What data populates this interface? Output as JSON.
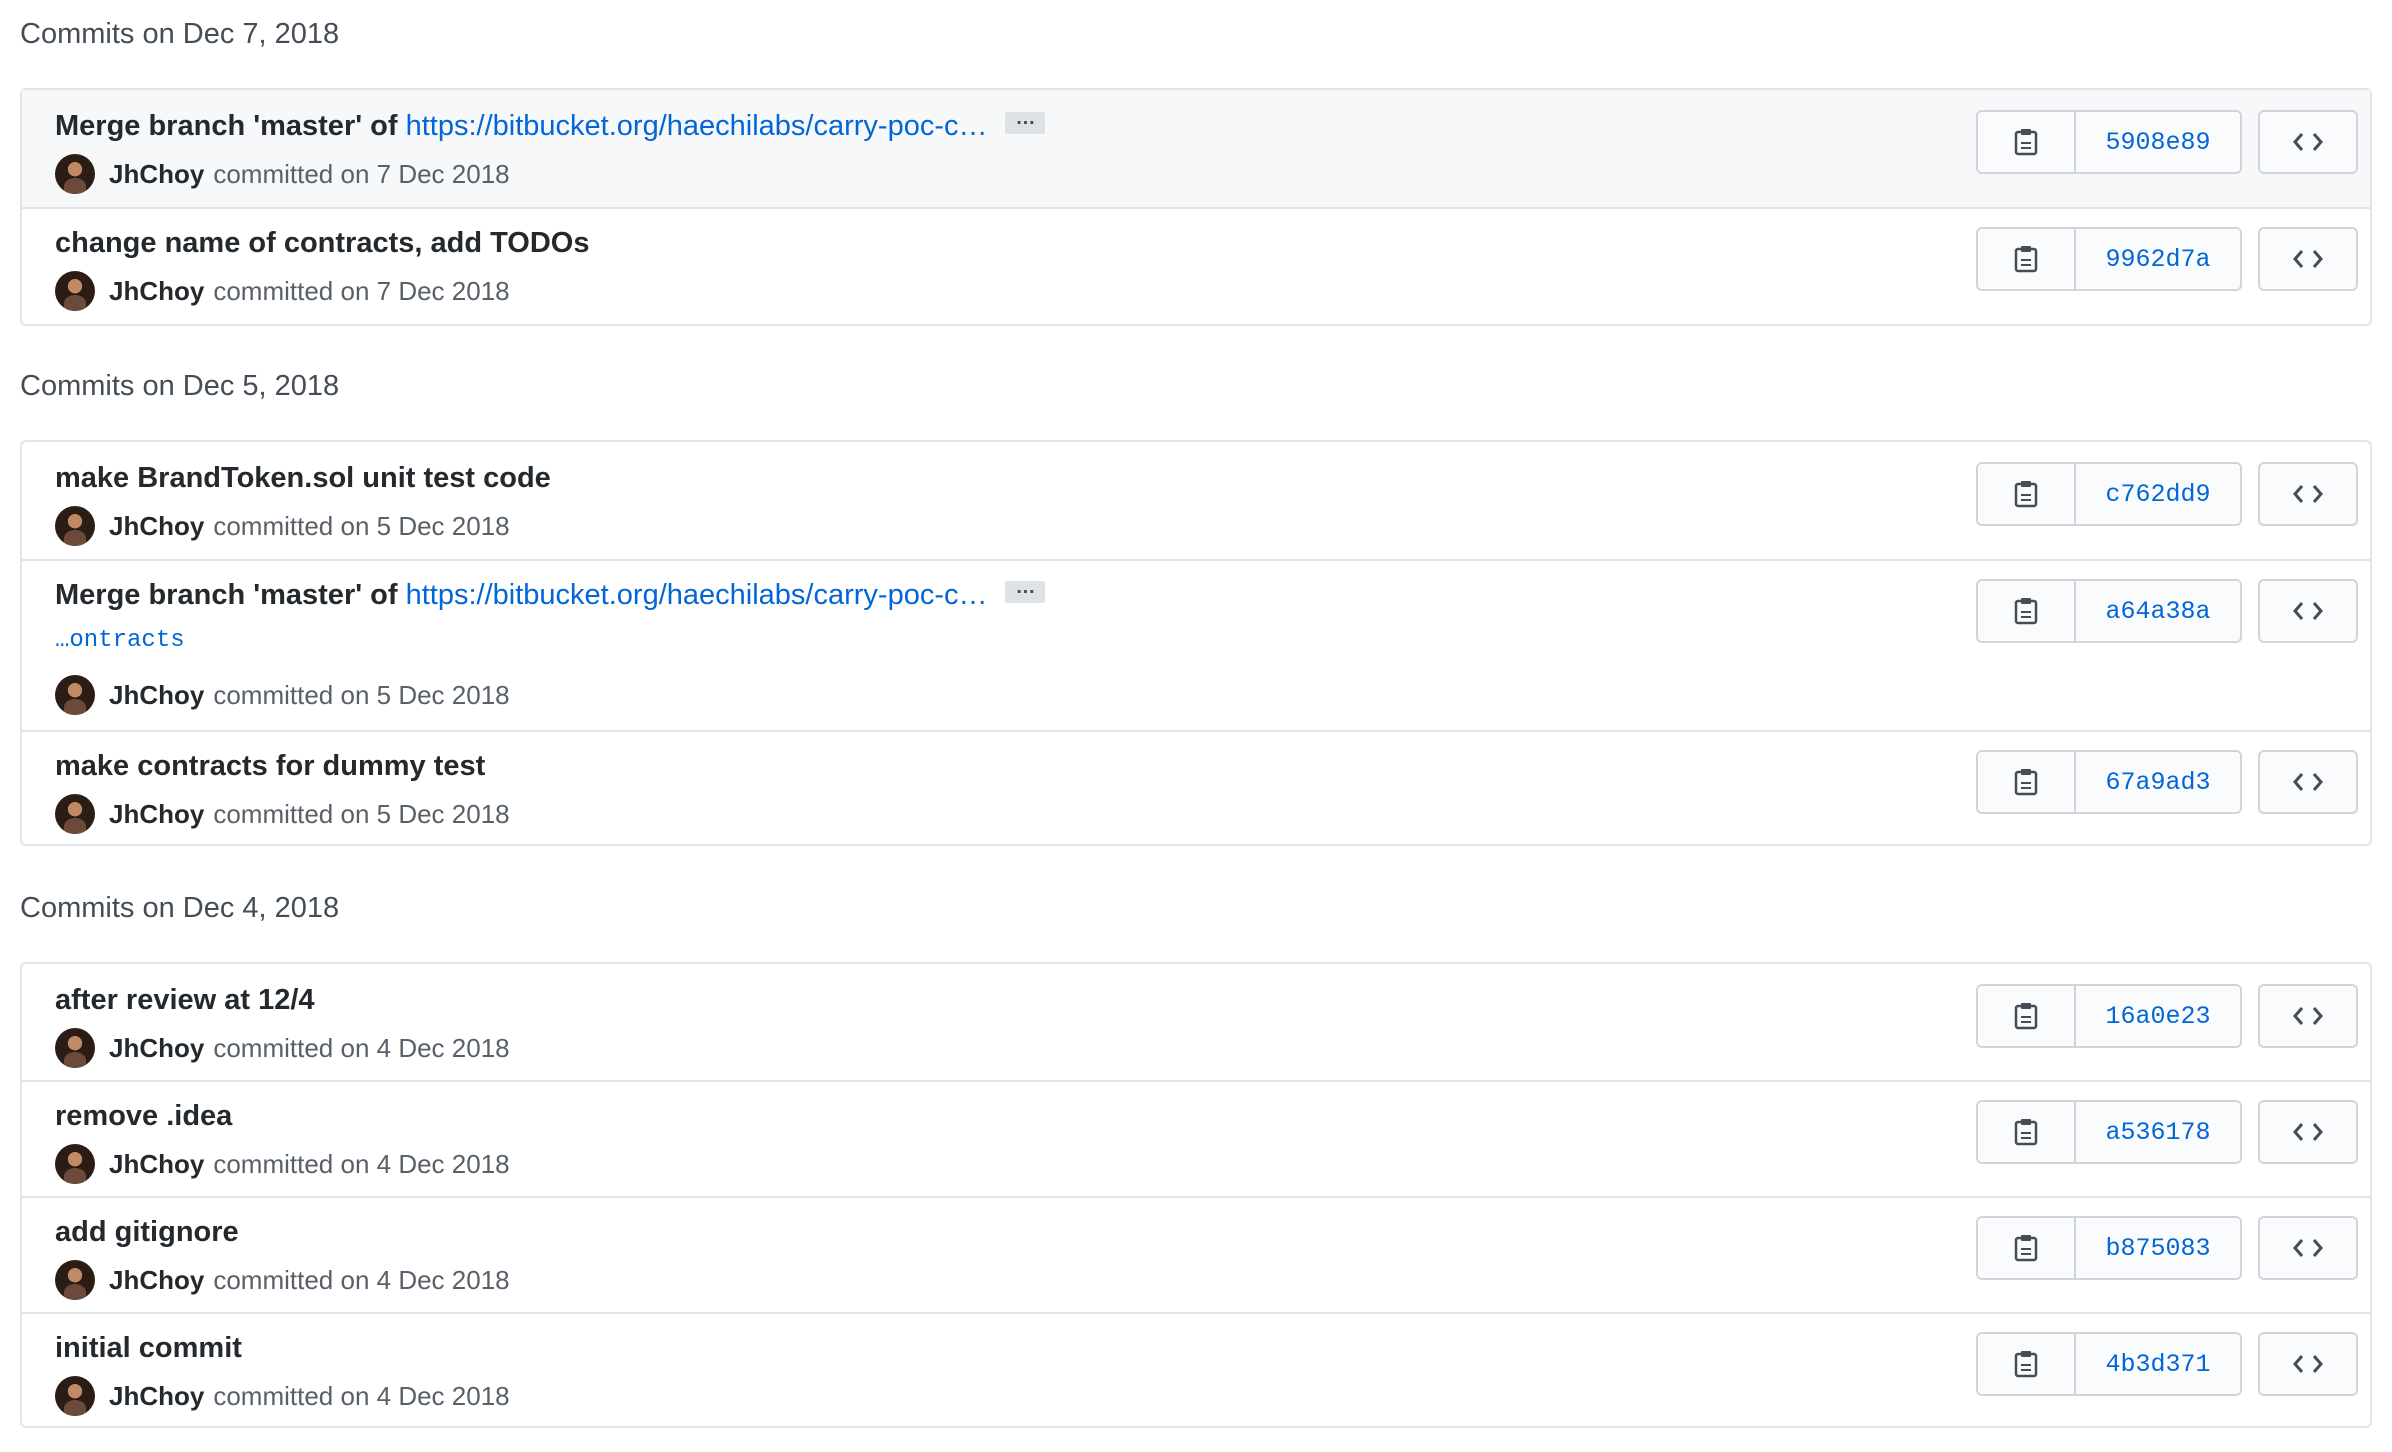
{
  "groups": [
    {
      "header": "Commits on Dec 7, 2018",
      "commits": [
        {
          "title": "Merge branch 'master' of ",
          "link": "https://bitbucket.org/haechilabs/carry-poc-c…",
          "has_ellipsis": true,
          "ellipsis_label": "…",
          "author": "JhChoy",
          "date_text": "committed on 7 Dec 2018",
          "sha": "5908e89",
          "highlight": true
        },
        {
          "title": "change name of contracts, add TODOs",
          "author": "JhChoy",
          "date_text": "committed on 7 Dec 2018",
          "sha": "9962d7a"
        }
      ]
    },
    {
      "header": "Commits on Dec 5, 2018",
      "commits": [
        {
          "title": "make BrandToken.sol unit test code",
          "author": "JhChoy",
          "date_text": "committed on 5 Dec 2018",
          "sha": "c762dd9"
        },
        {
          "title": "Merge branch 'master' of ",
          "link": "https://bitbucket.org/haechilabs/carry-poc-c…",
          "has_ellipsis": true,
          "ellipsis_label": "…",
          "continuation": "…ontracts",
          "author": "JhChoy",
          "date_text": "committed on 5 Dec 2018",
          "sha": "a64a38a"
        },
        {
          "title": "make contracts for dummy test",
          "author": "JhChoy",
          "date_text": "committed on 5 Dec 2018",
          "sha": "67a9ad3"
        }
      ]
    },
    {
      "header": "Commits on Dec 4, 2018",
      "commits": [
        {
          "title": "after review at 12/4",
          "author": "JhChoy",
          "date_text": "committed on 4 Dec 2018",
          "sha": "16a0e23"
        },
        {
          "title": "remove .idea",
          "author": "JhChoy",
          "date_text": "committed on 4 Dec 2018",
          "sha": "a536178"
        },
        {
          "title": "add gitignore",
          "author": "JhChoy",
          "date_text": "committed on 4 Dec 2018",
          "sha": "b875083"
        },
        {
          "title": "initial commit",
          "author": "JhChoy",
          "date_text": "committed on 4 Dec 2018",
          "sha": "4b3d371"
        }
      ]
    }
  ],
  "icons": {
    "copy": "clipboard-icon",
    "browse": "code-icon",
    "avatar": "avatar"
  },
  "colors": {
    "link": "#0366d6",
    "highlight_row": "#f6f8fa",
    "border": "#e1e4e8"
  }
}
